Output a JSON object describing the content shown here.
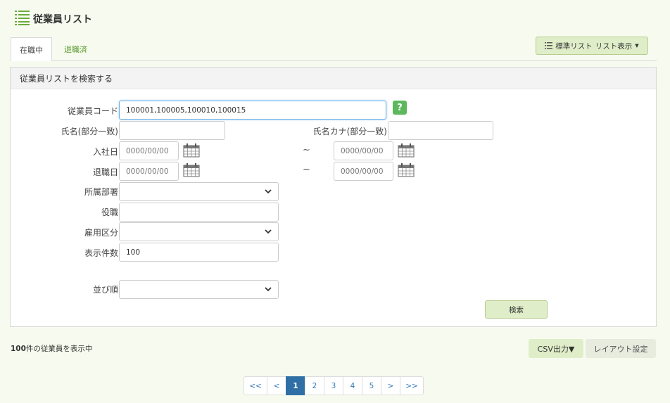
{
  "page": {
    "title": "従業員リスト"
  },
  "tabs": [
    {
      "label": "在職中"
    },
    {
      "label": "退職済"
    }
  ],
  "std_list_button": {
    "label": "標準リスト",
    "sep": "リスト表示"
  },
  "panel": {
    "title": "従業員リストを検索する"
  },
  "form": {
    "employee_code": {
      "label": "従業員コード",
      "value": "100001,100005,100010,100015"
    },
    "name": {
      "label": "氏名(部分一致)",
      "value": ""
    },
    "name_kana": {
      "label": "氏名カナ(部分一致)",
      "value": ""
    },
    "hire_date": {
      "label": "入社日",
      "from_placeholder": "0000/00/00",
      "to_placeholder": "0000/00/00"
    },
    "retire_date": {
      "label": "退職日",
      "from_placeholder": "0000/00/00",
      "to_placeholder": "0000/00/00"
    },
    "department": {
      "label": "所属部署",
      "value": ""
    },
    "position": {
      "label": "役職",
      "value": ""
    },
    "employment_type": {
      "label": "雇用区分",
      "value": ""
    },
    "display_count": {
      "label": "表示件数",
      "value": "100"
    },
    "sort_order": {
      "label": "並び順",
      "value": ""
    },
    "tilde": "~",
    "help": "?",
    "search_button": "検索"
  },
  "results": {
    "count_bold": "100",
    "count_text": "件の従業員を表示中"
  },
  "csv_button": "CSV出力▼",
  "layout_button": "レイアウト設定",
  "pagination": {
    "first": "<<",
    "prev": "<",
    "pages": [
      "1",
      "2",
      "3",
      "4",
      "5"
    ],
    "next": ">",
    "last": ">>",
    "current": "1"
  },
  "colors": {
    "accent": "#5cb85c",
    "button_bg": "#dfeec8",
    "page_active": "#2f6fa6",
    "background": "#f7fbef"
  }
}
